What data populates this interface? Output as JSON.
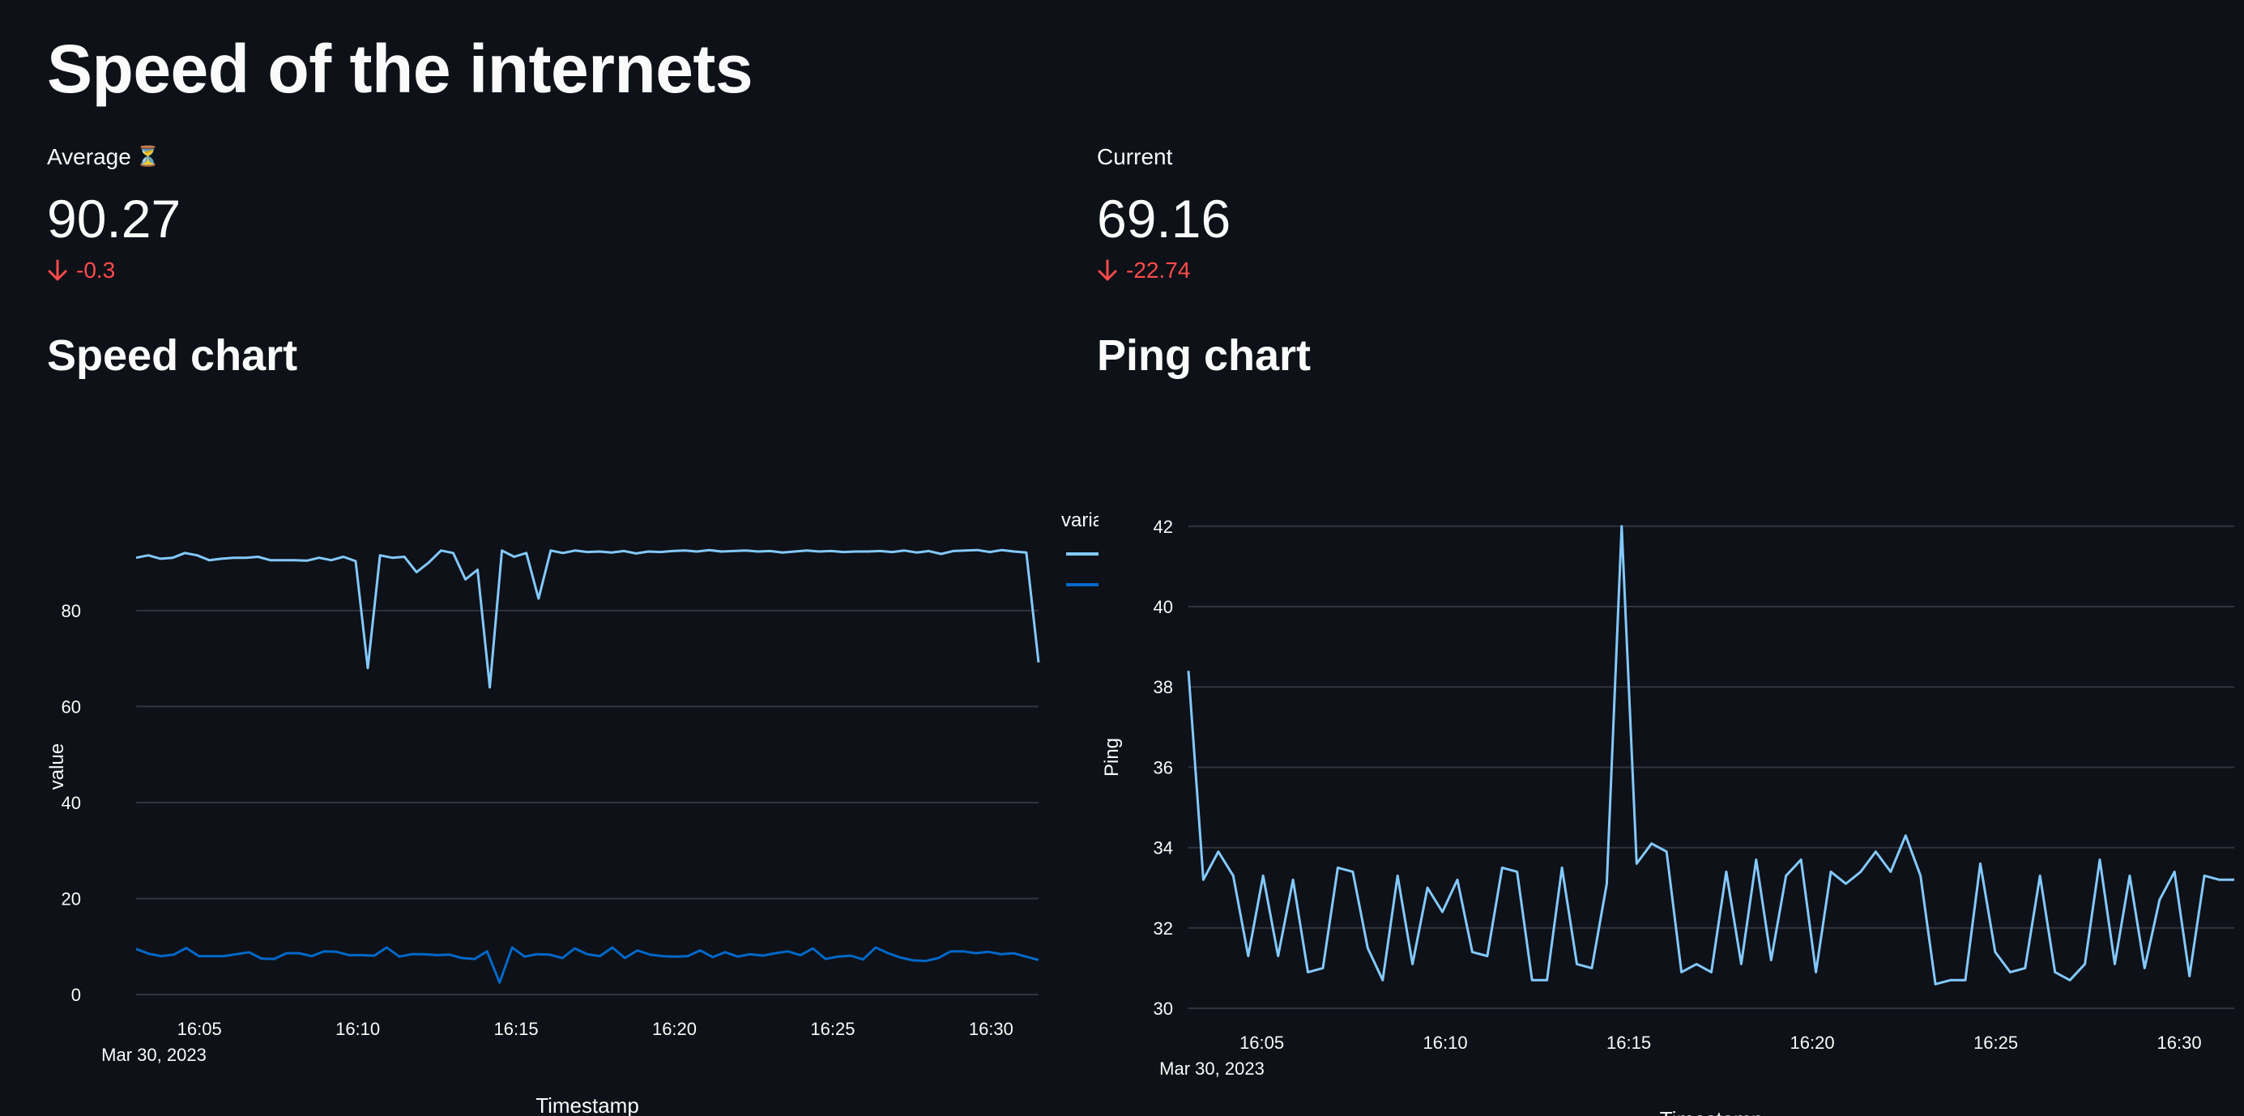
{
  "page": {
    "title": "Speed of the internets"
  },
  "metrics": {
    "average": {
      "label": "Average",
      "icon": "hourglass-icon",
      "value": "90.27",
      "delta": "-0.3",
      "delta_color": "#ff4b4b"
    },
    "current": {
      "label": "Current",
      "value": "69.16",
      "delta": "-22.74",
      "delta_color": "#ff4b4b"
    }
  },
  "sections": {
    "speed_title": "Speed chart",
    "ping_title": "Ping chart"
  },
  "colors": {
    "background": "#0e1117",
    "series_light": "#83c9ff",
    "series_dark": "#0068c9",
    "grid": "#31333f",
    "delta_negative": "#ff4b4b"
  },
  "chart_data": [
    {
      "type": "line",
      "xlabel": "Timestamp",
      "ylabel": "value",
      "xlim": [
        "16:03",
        "16:31:30"
      ],
      "ylim": [
        0,
        95
      ],
      "x_ticks": [
        "16:05",
        "16:10",
        "16:15",
        "16:20",
        "16:25",
        "16:30"
      ],
      "x_date_label": "Mar 30, 2023",
      "y_ticks": [
        0,
        20,
        40,
        60,
        80
      ],
      "grid": true,
      "legend": {
        "title": "varia",
        "placement": "top-right",
        "entries": [
          "",
          ""
        ]
      },
      "series": [
        {
          "color": "#83c9ff",
          "values": [
            91,
            91.5,
            90.8,
            91,
            92,
            91.5,
            90.5,
            90.8,
            91,
            91,
            91.2,
            90.5,
            90.5,
            90.5,
            90.4,
            91,
            90.5,
            91.2,
            90.3,
            68,
            91.5,
            91,
            91.2,
            88,
            90,
            92.5,
            92,
            86.5,
            88.5,
            64,
            92.5,
            91.2,
            92,
            82.5,
            92.5,
            92,
            92.5,
            92.2,
            92.3,
            92.1,
            92.4,
            91.9,
            92.3,
            92.2,
            92.4,
            92.5,
            92.3,
            92.6,
            92.3,
            92.4,
            92.5,
            92.3,
            92.4,
            92.1,
            92.3,
            92.5,
            92.3,
            92.4,
            92.2,
            92.3,
            92.3,
            92.4,
            92.2,
            92.5,
            92.1,
            92.4,
            91.8,
            92.4,
            92.5,
            92.6,
            92.2,
            92.6,
            92.3,
            92.1,
            69.2
          ]
        },
        {
          "color": "#0068c9",
          "values": [
            9.5,
            8.5,
            8.0,
            8.3,
            9.7,
            8.0,
            8.0,
            8.0,
            8.4,
            8.8,
            7.5,
            7.4,
            8.6,
            8.6,
            8.0,
            9.0,
            8.9,
            8.2,
            8.2,
            8.1,
            9.8,
            7.9,
            8.4,
            8.4,
            8.2,
            8.3,
            7.6,
            7.4,
            9.0,
            2.5,
            9.8,
            7.9,
            8.4,
            8.3,
            7.6,
            9.6,
            8.4,
            8.0,
            9.8,
            7.6,
            9.2,
            8.3,
            8.0,
            7.9,
            8.0,
            9.2,
            7.8,
            8.8,
            7.9,
            8.4,
            8.1,
            8.6,
            9.0,
            8.2,
            9.6,
            7.4,
            7.9,
            8.1,
            7.3,
            9.8,
            8.6,
            7.7,
            7.1,
            7.0,
            7.6,
            9.0,
            9.0,
            8.6,
            8.9,
            8.4,
            8.6,
            7.9,
            7.2
          ]
        }
      ]
    },
    {
      "type": "line",
      "xlabel": "Timestamp",
      "ylabel": "Ping",
      "xlim": [
        "16:03",
        "16:31:30"
      ],
      "ylim": [
        30,
        42.5
      ],
      "x_ticks": [
        "16:05",
        "16:10",
        "16:15",
        "16:20",
        "16:25",
        "16:30"
      ],
      "x_date_label": "Mar 30, 2023",
      "y_ticks": [
        30,
        32,
        34,
        36,
        38,
        40,
        42
      ],
      "grid": true,
      "series": [
        {
          "color": "#83c9ff",
          "values": [
            38.4,
            33.2,
            33.9,
            33.3,
            31.3,
            33.3,
            31.3,
            33.2,
            30.9,
            31.0,
            33.5,
            33.4,
            31.5,
            30.7,
            33.3,
            31.1,
            33.0,
            32.4,
            33.2,
            31.4,
            31.3,
            33.5,
            33.4,
            30.7,
            30.7,
            33.5,
            31.1,
            31.0,
            33.1,
            42.0,
            33.6,
            34.1,
            33.9,
            30.9,
            31.1,
            30.9,
            33.4,
            31.1,
            33.7,
            31.2,
            33.3,
            33.7,
            30.9,
            33.4,
            33.1,
            33.4,
            33.9,
            33.4,
            34.3,
            33.3,
            30.6,
            30.7,
            30.7,
            33.6,
            31.4,
            30.9,
            31.0,
            33.3,
            30.9,
            30.7,
            31.1,
            33.7,
            31.1,
            33.3,
            31.0,
            32.7,
            33.4,
            30.8,
            33.3,
            33.2,
            33.2
          ]
        }
      ]
    }
  ]
}
